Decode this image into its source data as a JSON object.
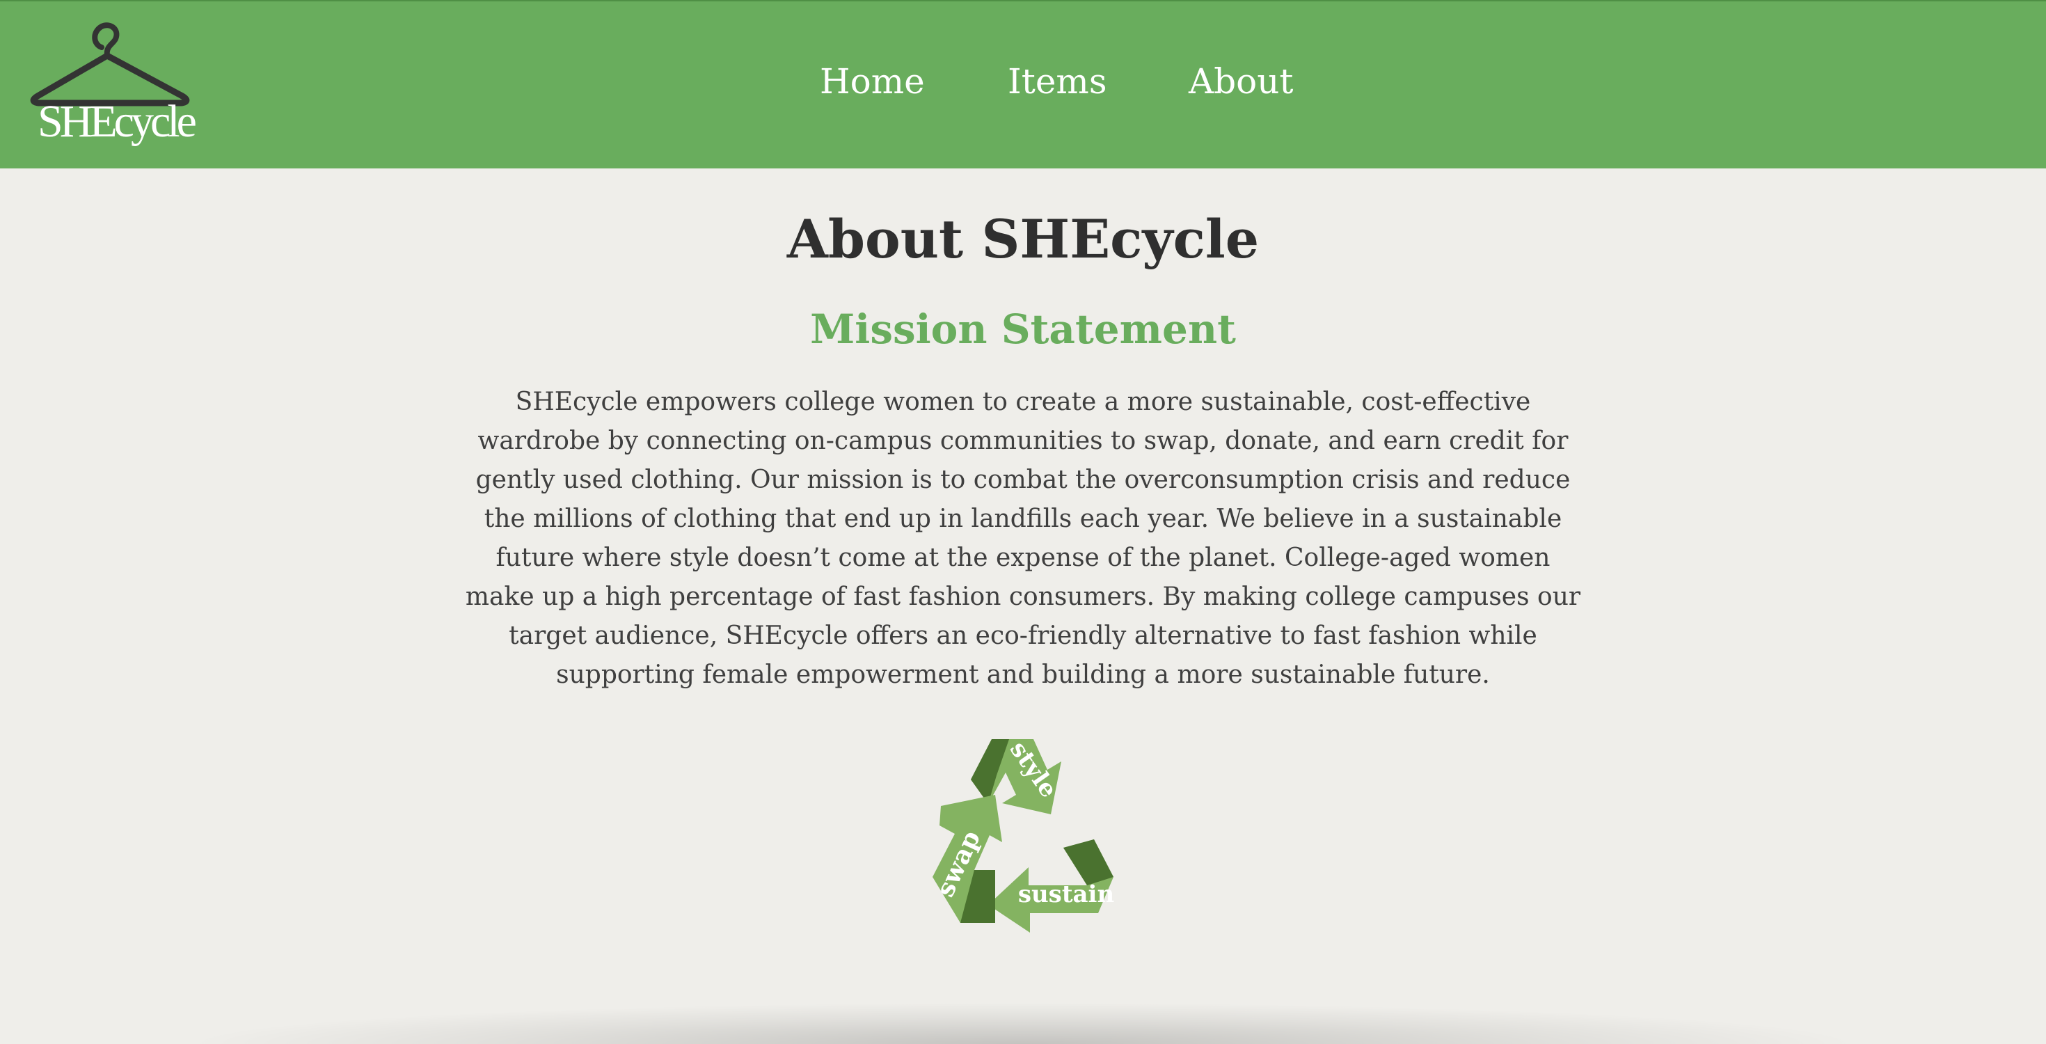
{
  "header": {
    "logo_text": "SHEcycle",
    "nav": [
      {
        "label": "Home"
      },
      {
        "label": "Items"
      },
      {
        "label": "About"
      }
    ]
  },
  "main": {
    "title": "About SHEcycle",
    "section_title": "Mission Statement",
    "mission_text": "SHEcycle empowers college women to create a more sustainable, cost-effective wardrobe by connecting on-campus communities to swap, donate, and earn credit for gently used clothing. Our mission is to combat the overconsumption crisis and reduce the millions of clothing that end up in landfills each year. We believe in a sustainable future where style doesn’t come at the expense of the planet. College-aged women make up a high percentage of fast fashion consumers. By making college campuses our target audience, SHEcycle offers an eco-friendly alternative to fast fashion while supporting female empowerment and building a more sustainable future."
  },
  "recycle_graphic": {
    "labels": [
      "style",
      "sustain",
      "swap"
    ]
  },
  "colors": {
    "brand_green": "#69ad5d",
    "dark_green": "#4a722f",
    "light_green": "#84b361",
    "background": "#efeeea"
  }
}
